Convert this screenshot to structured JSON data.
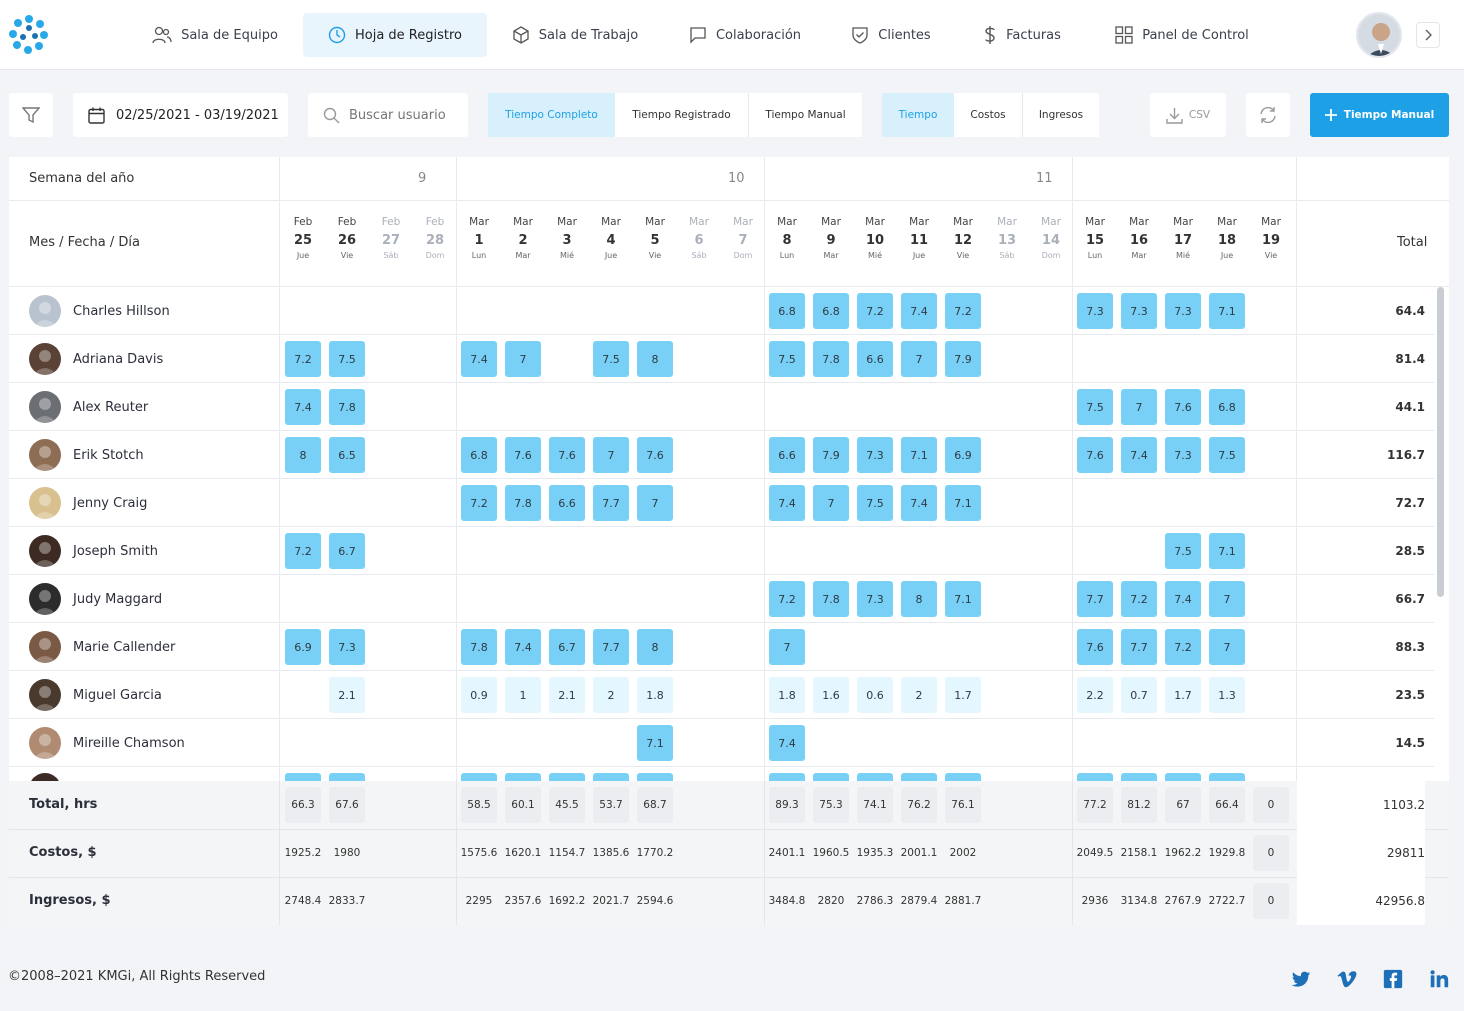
{
  "nav": [
    {
      "label": "Sala de Equipo",
      "icon": "users-icon",
      "active": false
    },
    {
      "label": "Hoja de Registro",
      "icon": "clock-icon",
      "active": true
    },
    {
      "label": "Sala de Trabajo",
      "icon": "box-icon",
      "active": false
    },
    {
      "label": "Colaboración",
      "icon": "chat-icon",
      "active": false
    },
    {
      "label": "Clientes",
      "icon": "shield-check-icon",
      "active": false
    },
    {
      "label": "Facturas",
      "icon": "dollar-icon",
      "active": false
    },
    {
      "label": "Panel de Control",
      "icon": "grid-icon",
      "active": false
    }
  ],
  "toolbar": {
    "date_range": "02/25/2021 - 03/19/2021",
    "search_placeholder": "Buscar usuario",
    "mode_tabs": [
      "Tiempo Completo",
      "Tiempo Registrado",
      "Tiempo Manual"
    ],
    "mode_active": 0,
    "metric_tabs": [
      "Tiempo",
      "Costos",
      "Ingresos"
    ],
    "metric_active": 0,
    "csv_label": "CSV",
    "add_label": "Tiempo Manual"
  },
  "table": {
    "week_header": "Semana del año",
    "date_header": "Mes / Fecha / Día",
    "total_header": "Total",
    "weeks": [
      "9",
      "10",
      "11"
    ],
    "days": [
      {
        "m": "Feb",
        "d": "25",
        "w": "Jue",
        "weekend": false
      },
      {
        "m": "Feb",
        "d": "26",
        "w": "Vie",
        "weekend": false
      },
      {
        "m": "Feb",
        "d": "27",
        "w": "Sáb",
        "weekend": true
      },
      {
        "m": "Feb",
        "d": "28",
        "w": "Dom",
        "weekend": true
      },
      {
        "m": "Mar",
        "d": "1",
        "w": "Lun",
        "weekend": false
      },
      {
        "m": "Mar",
        "d": "2",
        "w": "Mar",
        "weekend": false
      },
      {
        "m": "Mar",
        "d": "3",
        "w": "Mié",
        "weekend": false
      },
      {
        "m": "Mar",
        "d": "4",
        "w": "Jue",
        "weekend": false
      },
      {
        "m": "Mar",
        "d": "5",
        "w": "Vie",
        "weekend": false
      },
      {
        "m": "Mar",
        "d": "6",
        "w": "Sáb",
        "weekend": true
      },
      {
        "m": "Mar",
        "d": "7",
        "w": "Dom",
        "weekend": true
      },
      {
        "m": "Mar",
        "d": "8",
        "w": "Lun",
        "weekend": false
      },
      {
        "m": "Mar",
        "d": "9",
        "w": "Mar",
        "weekend": false
      },
      {
        "m": "Mar",
        "d": "10",
        "w": "Mié",
        "weekend": false
      },
      {
        "m": "Mar",
        "d": "11",
        "w": "Jue",
        "weekend": false
      },
      {
        "m": "Mar",
        "d": "12",
        "w": "Vie",
        "weekend": false
      },
      {
        "m": "Mar",
        "d": "13",
        "w": "Sáb",
        "weekend": true
      },
      {
        "m": "Mar",
        "d": "14",
        "w": "Dom",
        "weekend": true
      },
      {
        "m": "Mar",
        "d": "15",
        "w": "Lun",
        "weekend": false
      },
      {
        "m": "Mar",
        "d": "16",
        "w": "Mar",
        "weekend": false
      },
      {
        "m": "Mar",
        "d": "17",
        "w": "Mié",
        "weekend": false
      },
      {
        "m": "Mar",
        "d": "18",
        "w": "Jue",
        "weekend": false
      },
      {
        "m": "Mar",
        "d": "19",
        "w": "Vie",
        "weekend": false
      }
    ],
    "rows": [
      {
        "name": "Charles Hillson",
        "total": "64.4",
        "avatar_color": "#b9c3cf",
        "cells": {
          "11": "6.8",
          "12": "6.8",
          "13": "7.2",
          "14": "7.4",
          "15": "7.2",
          "18": "7.3",
          "19": "7.3",
          "20": "7.3",
          "21": "7.1"
        }
      },
      {
        "name": "Adriana Davis",
        "total": "81.4",
        "avatar_color": "#5a4236",
        "cells": {
          "0": "7.2",
          "1": "7.5",
          "4": "7.4",
          "5": "7",
          "7": "7.5",
          "8": "8",
          "11": "7.5",
          "12": "7.8",
          "13": "6.6",
          "14": "7",
          "15": "7.9"
        }
      },
      {
        "name": "Alex Reuter",
        "total": "44.1",
        "avatar_color": "#6b6e73",
        "cells": {
          "0": "7.4",
          "1": "7.8",
          "18": "7.5",
          "19": "7",
          "20": "7.6",
          "21": "6.8"
        }
      },
      {
        "name": "Erik Stotch",
        "total": "116.7",
        "avatar_color": "#8e6d55",
        "cells": {
          "0": "8",
          "1": "6.5",
          "4": "6.8",
          "5": "7.6",
          "6": "7.6",
          "7": "7",
          "8": "7.6",
          "11": "6.6",
          "12": "7.9",
          "13": "7.3",
          "14": "7.1",
          "15": "6.9",
          "18": "7.6",
          "19": "7.4",
          "20": "7.3",
          "21": "7.5"
        }
      },
      {
        "name": "Jenny Craig",
        "total": "72.7",
        "avatar_color": "#d8c08f",
        "cells": {
          "4": "7.2",
          "5": "7.8",
          "6": "6.6",
          "7": "7.7",
          "8": "7",
          "11": "7.4",
          "12": "7",
          "13": "7.5",
          "14": "7.4",
          "15": "7.1"
        }
      },
      {
        "name": "Joseph Smith",
        "total": "28.5",
        "avatar_color": "#3d2a22",
        "cells": {
          "0": "7.2",
          "1": "6.7",
          "20": "7.5",
          "21": "7.1"
        }
      },
      {
        "name": "Judy Maggard",
        "total": "66.7",
        "avatar_color": "#2c2c2c",
        "cells": {
          "11": "7.2",
          "12": "7.8",
          "13": "7.3",
          "14": "8",
          "15": "7.1",
          "18": "7.7",
          "19": "7.2",
          "20": "7.4",
          "21": "7"
        }
      },
      {
        "name": "Marie Callender",
        "total": "88.3",
        "avatar_color": "#7a5a45",
        "cells": {
          "0": "6.9",
          "1": "7.3",
          "4": "7.8",
          "5": "7.4",
          "6": "6.7",
          "7": "7.7",
          "8": "8",
          "11": "7",
          "18": "7.6",
          "19": "7.7",
          "20": "7.2",
          "21": "7"
        }
      },
      {
        "name": "Miguel Garcia",
        "total": "23.5",
        "avatar_color": "#4a3a2e",
        "lite": true,
        "cells": {
          "1": "2.1",
          "4": "0.9",
          "5": "1",
          "6": "2.1",
          "7": "2",
          "8": "1.8",
          "11": "1.8",
          "12": "1.6",
          "13": "0.6",
          "14": "2",
          "15": "1.7",
          "18": "2.2",
          "19": "0.7",
          "20": "1.7",
          "21": "1.3"
        }
      },
      {
        "name": "Mireille Chamson",
        "total": "14.5",
        "avatar_color": "#b08b72",
        "cells": {
          "8": "7.1",
          "11": "7.4"
        }
      }
    ],
    "partial_row_cols": [
      0,
      1,
      4,
      5,
      6,
      7,
      8,
      11,
      12,
      13,
      14,
      15,
      18,
      19,
      20,
      21
    ]
  },
  "summary": {
    "total_label": "Total, hrs",
    "cost_label": "Costos, $",
    "income_label": "Ingresos, $",
    "hours": {
      "0": "66.3",
      "1": "67.6",
      "4": "58.5",
      "5": "60.1",
      "6": "45.5",
      "7": "53.7",
      "8": "68.7",
      "11": "89.3",
      "12": "75.3",
      "13": "74.1",
      "14": "76.2",
      "15": "76.1",
      "18": "77.2",
      "19": "81.2",
      "20": "67",
      "21": "66.4",
      "22": "0"
    },
    "costs": {
      "0": "1925.2",
      "1": "1980",
      "4": "1575.6",
      "5": "1620.1",
      "6": "1154.7",
      "7": "1385.6",
      "8": "1770.2",
      "11": "2401.1",
      "12": "1960.5",
      "13": "1935.3",
      "14": "2001.1",
      "15": "2002",
      "18": "2049.5",
      "19": "2158.1",
      "20": "1962.2",
      "21": "1929.8",
      "22": "0"
    },
    "income": {
      "0": "2748.4",
      "1": "2833.7",
      "4": "2295",
      "5": "2357.6",
      "6": "1692.2",
      "7": "2021.7",
      "8": "2594.6",
      "11": "3484.8",
      "12": "2820",
      "13": "2786.3",
      "14": "2879.4",
      "15": "2881.7",
      "18": "2936",
      "19": "3134.8",
      "20": "2767.9",
      "21": "2722.7",
      "22": "0"
    },
    "grand_hours": "1103.2",
    "grand_costs": "29811",
    "grand_income": "42956.8"
  },
  "footer": {
    "copyright": "©2008–2021 KMGi, All Rights Reserved",
    "social": [
      "twitter-icon",
      "vimeo-icon",
      "facebook-icon",
      "linkedin-icon"
    ]
  },
  "colors": {
    "accent": "#1ea0e6",
    "cell": "#79d0f7",
    "cell_light": "#e4f6fe"
  }
}
